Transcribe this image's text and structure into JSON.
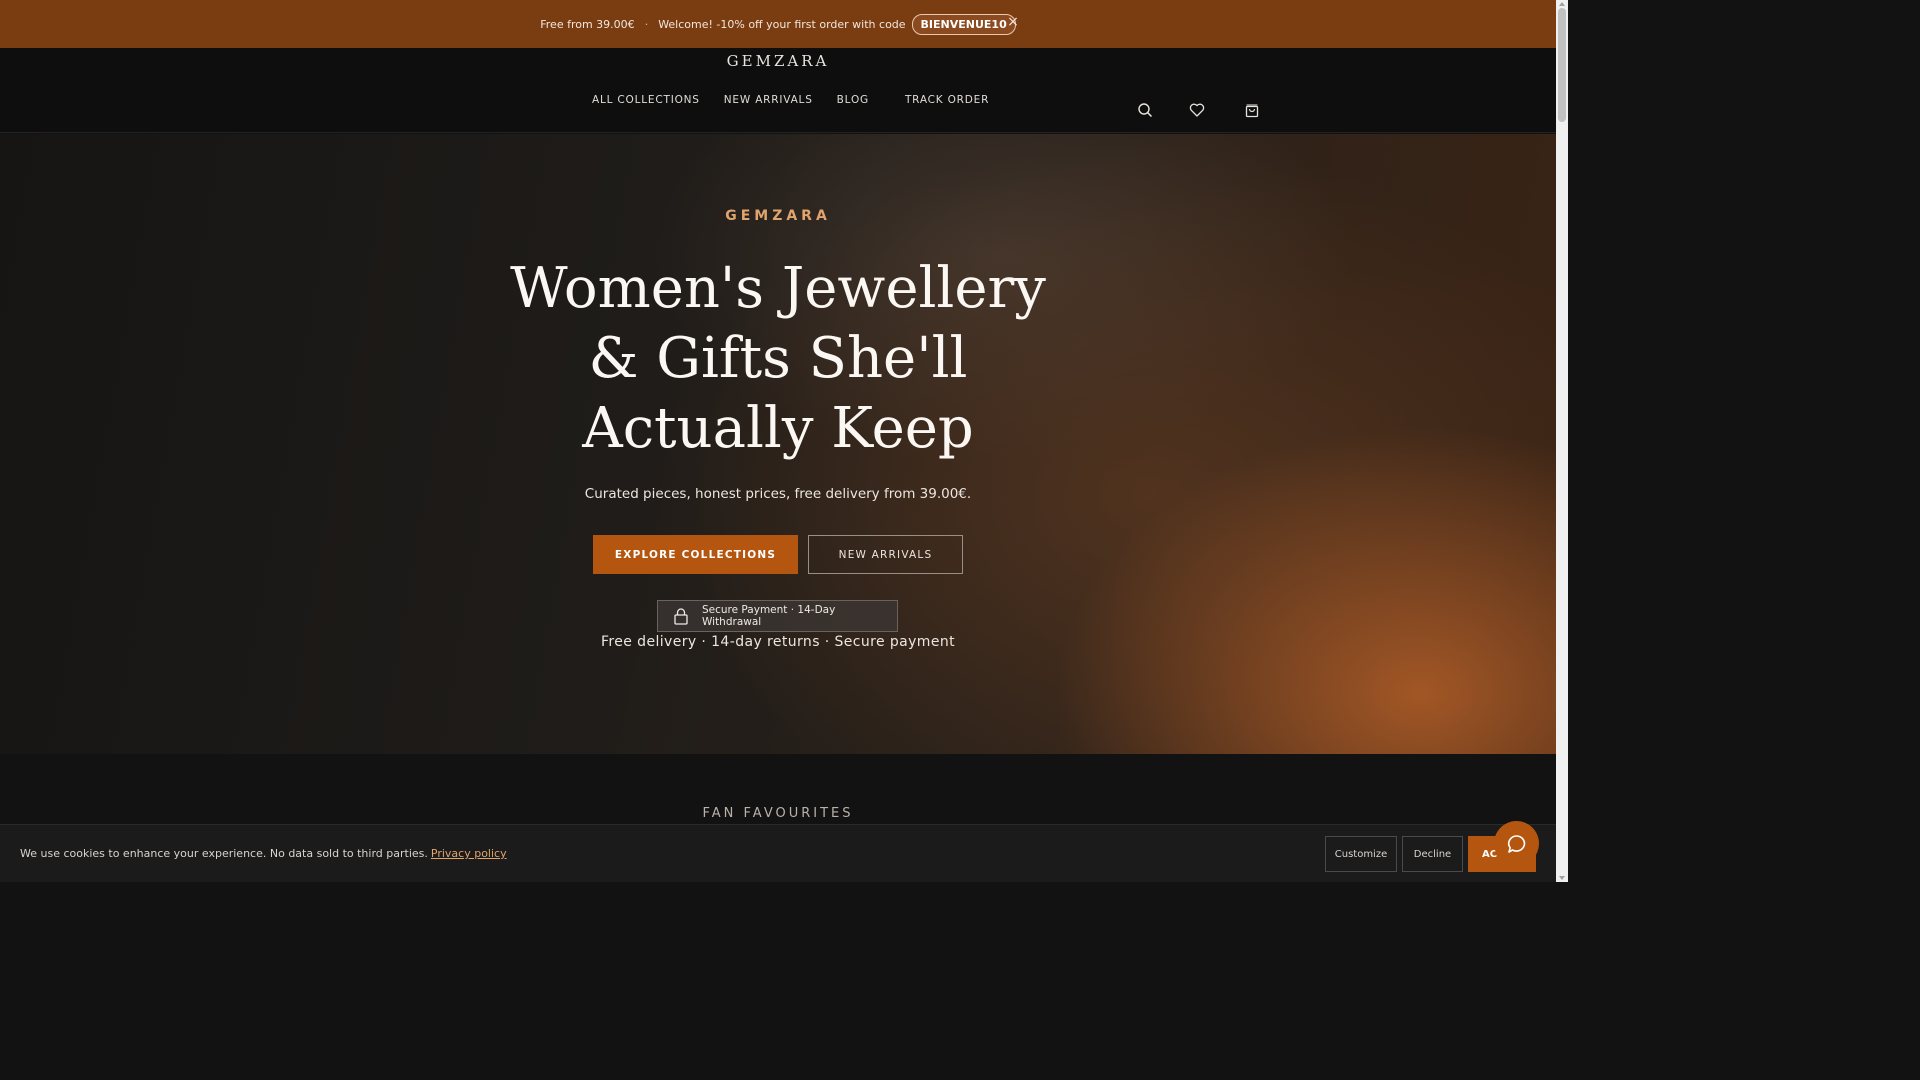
{
  "announcement": {
    "free_delivery": "Free from 39.00€",
    "separator": "·",
    "welcome": "Welcome! -10% off your first order with code",
    "code": "BIENVENUE10",
    "close_glyph": "×"
  },
  "header": {
    "logo": "GEMZARA",
    "nav": [
      "ALL COLLECTIONS",
      "NEW ARRIVALS",
      "BLOG",
      "TRACK ORDER"
    ],
    "icons": [
      "search-icon",
      "heart-icon",
      "bag-icon"
    ]
  },
  "hero": {
    "eyebrow": "GEMZARA",
    "headline": "Women's Jewellery & Gifts She'll Actually Keep",
    "subtitle": "Curated pieces, honest prices, free delivery from 39.00€.",
    "primary_cta": "EXPLORE COLLECTIONS",
    "secondary_cta": "NEW ARRIVALS",
    "secure_badge": "Secure Payment · 14-Day Withdrawal",
    "tagline": "Free delivery · 14-day returns · Secure payment"
  },
  "section": {
    "fan_favourites": "FAN FAVOURITES"
  },
  "cookie": {
    "message": "We use cookies to enhance your experience. No data sold to third parties.",
    "privacy_link": "Privacy policy",
    "customize": "Customize",
    "decline": "Decline",
    "accept": "AC"
  },
  "colors": {
    "accent": "#b4560f",
    "announcement_bg": "#7a3d12",
    "eyebrow": "#e0a46c",
    "header_bg": "#0e0e0e"
  }
}
